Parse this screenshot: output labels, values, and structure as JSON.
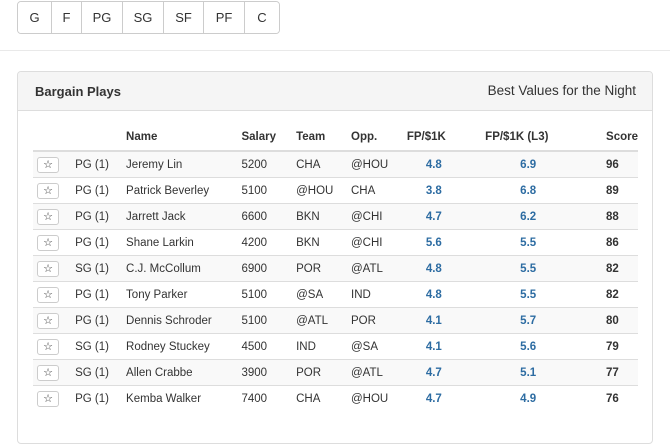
{
  "position_filters": [
    "G",
    "F",
    "PG",
    "SG",
    "SF",
    "PF",
    "C"
  ],
  "panel": {
    "title": "Bargain Plays",
    "subtitle": "Best Values for the Night"
  },
  "table": {
    "headers": [
      "",
      "",
      "Name",
      "Salary",
      "Team",
      "Opp.",
      "FP/$1K",
      "FP/$1K (L3)",
      "Score"
    ],
    "rows": [
      {
        "pos": "PG (1)",
        "name": "Jeremy Lin",
        "salary": "5200",
        "team": "CHA",
        "opp": "@HOU",
        "fp": "4.8",
        "fp_l3": "6.9",
        "score": "96"
      },
      {
        "pos": "PG (1)",
        "name": "Patrick Beverley",
        "salary": "5100",
        "team": "@HOU",
        "opp": "CHA",
        "fp": "3.8",
        "fp_l3": "6.8",
        "score": "89"
      },
      {
        "pos": "PG (1)",
        "name": "Jarrett Jack",
        "salary": "6600",
        "team": "BKN",
        "opp": "@CHI",
        "fp": "4.7",
        "fp_l3": "6.2",
        "score": "88"
      },
      {
        "pos": "PG (1)",
        "name": "Shane Larkin",
        "salary": "4200",
        "team": "BKN",
        "opp": "@CHI",
        "fp": "5.6",
        "fp_l3": "5.5",
        "score": "86"
      },
      {
        "pos": "SG (1)",
        "name": "C.J. McCollum",
        "salary": "6900",
        "team": "POR",
        "opp": "@ATL",
        "fp": "4.8",
        "fp_l3": "5.5",
        "score": "82"
      },
      {
        "pos": "PG (1)",
        "name": "Tony Parker",
        "salary": "5100",
        "team": "@SA",
        "opp": "IND",
        "fp": "4.8",
        "fp_l3": "5.5",
        "score": "82"
      },
      {
        "pos": "PG (1)",
        "name": "Dennis Schroder",
        "salary": "5100",
        "team": "@ATL",
        "opp": "POR",
        "fp": "4.1",
        "fp_l3": "5.7",
        "score": "80"
      },
      {
        "pos": "SG (1)",
        "name": "Rodney Stuckey",
        "salary": "4500",
        "team": "IND",
        "opp": "@SA",
        "fp": "4.1",
        "fp_l3": "5.6",
        "score": "79"
      },
      {
        "pos": "SG (1)",
        "name": "Allen Crabbe",
        "salary": "3900",
        "team": "POR",
        "opp": "@ATL",
        "fp": "4.7",
        "fp_l3": "5.1",
        "score": "77"
      },
      {
        "pos": "PG (1)",
        "name": "Kemba Walker",
        "salary": "7400",
        "team": "CHA",
        "opp": "@HOU",
        "fp": "4.7",
        "fp_l3": "4.9",
        "score": "76"
      }
    ]
  },
  "icons": {
    "star": "☆"
  },
  "colors": {
    "value_text": "#2d6ca2",
    "stripe": "#f9f9f9",
    "heading_bg": "#f5f5f5"
  }
}
